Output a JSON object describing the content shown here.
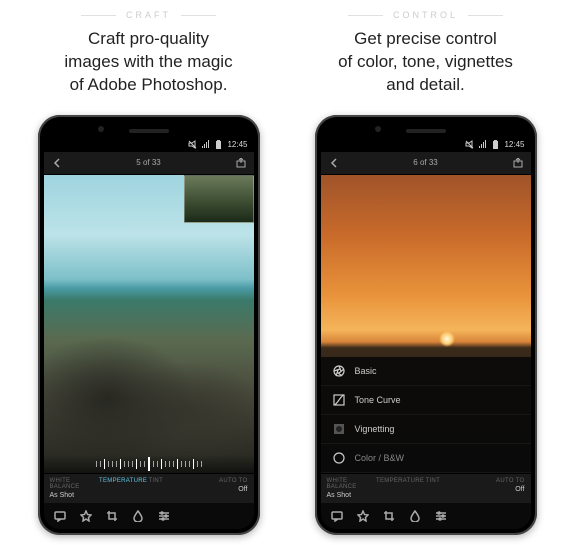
{
  "left": {
    "eyebrow": "CRAFT",
    "headline_line1": "Craft pro-quality",
    "headline_line2": "images with the magic",
    "headline_line3": "of Adobe Photoshop.",
    "status_time": "12:45",
    "counter": "5 of 33",
    "edit": {
      "wb_label": "WHITE BALANCE",
      "wb_value": "As Shot",
      "temp_label": "TEMPERATURE",
      "tint_label": "TINT",
      "auto_label": "AUTO TO",
      "auto_value": "Off"
    }
  },
  "right": {
    "eyebrow": "CONTROL",
    "headline_line1": "Get precise control",
    "headline_line2": "of color, tone, vignettes",
    "headline_line3": "and detail.",
    "status_time": "12:45",
    "counter": "6 of 33",
    "menu": {
      "basic": "Basic",
      "tone": "Tone Curve",
      "vignette": "Vignetting",
      "color": "Color / B&W"
    },
    "edit": {
      "wb_label": "WHITE BALANCE",
      "wb_value": "As Shot",
      "temp_label": "TEMPERATURE",
      "tint_label": "TINT",
      "auto_label": "AUTO TO",
      "auto_value": "Off"
    }
  }
}
